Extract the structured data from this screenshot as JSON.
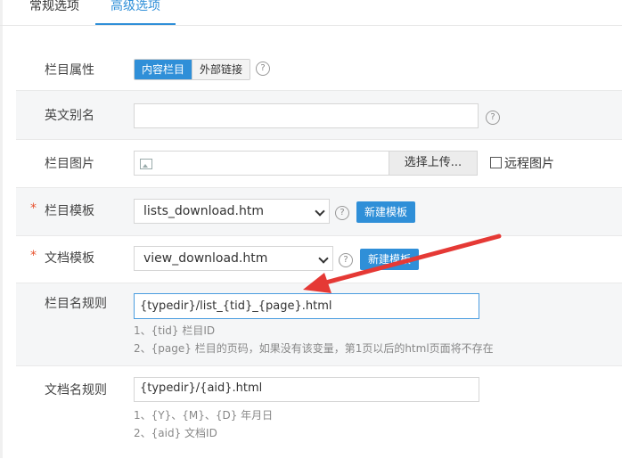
{
  "tabs": {
    "general": "常规选项",
    "advanced": "高级选项"
  },
  "fields": {
    "attribute": {
      "label": "栏目属性",
      "options": [
        "内容栏目",
        "外部链接"
      ],
      "selected": "内容栏目"
    },
    "alias": {
      "label": "英文别名",
      "value": ""
    },
    "image": {
      "label": "栏目图片",
      "upload_label": "选择上传...",
      "remote_label": "远程图片"
    },
    "category_template": {
      "required_mark": "*",
      "label": "栏目模板",
      "value": "lists_download.htm",
      "new_button": "新建模板"
    },
    "document_template": {
      "required_mark": "*",
      "label": "文档模板",
      "value": "view_download.htm",
      "new_button": "新建模板"
    },
    "category_rule": {
      "label": "栏目名规则",
      "value": "{typedir}/list_{tid}_{page}.html",
      "hints": [
        "1、{tid} 栏目ID",
        "2、{page} 栏目的页码，如果没有该变量，第1页以后的html页面将不存在"
      ]
    },
    "document_rule": {
      "label": "文档名规则",
      "value": "{typedir}/{aid}.html",
      "hints": [
        "1、{Y}、{M}、{D} 年月日",
        "2、{aid} 文档ID"
      ]
    }
  },
  "icons": {
    "help": "question-circle-icon",
    "image": "image-icon",
    "arrow": "red-arrow-annotation"
  },
  "colors": {
    "accent": "#2f8fd8",
    "required": "#e8532f",
    "annotation": "#e53935"
  }
}
